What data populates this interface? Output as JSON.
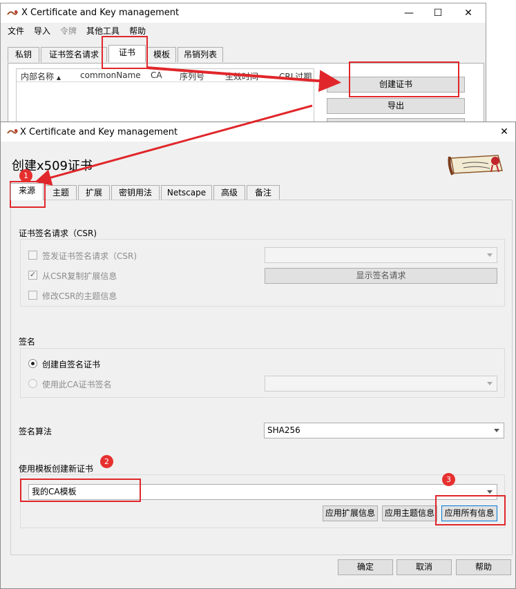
{
  "back_window": {
    "title": "X Certificate and Key management",
    "controls": {
      "minimize": "—",
      "maximize": "☐",
      "close": "✕"
    },
    "menu": [
      "文件",
      "导入",
      "令牌",
      "其他工具",
      "帮助"
    ],
    "tabs": [
      "私钥",
      "证书签名请求",
      "证书",
      "模板",
      "吊销列表"
    ],
    "columns": [
      "内部名称",
      "commonName",
      "CA",
      "序列号",
      "生效时间",
      "CRL过期"
    ],
    "sort_glyph": "▲",
    "buttons": {
      "create": "创建证书",
      "export": "导出"
    }
  },
  "dialog": {
    "title": "X Certificate and Key management",
    "close": "✕",
    "heading": "创建x509证书",
    "tabs": [
      "来源",
      "主题",
      "扩展",
      "密钥用法",
      "Netscape",
      "高级",
      "备注"
    ],
    "csr_section": {
      "title": "证书签名请求（CSR)",
      "sign_csr": "签发证书签名请求（CSR)",
      "copy_ext": "从CSR复制扩展信息",
      "modify_subject": "修改CSR的主题信息",
      "show_request": "显示签名请求",
      "check": "✓"
    },
    "signing": {
      "title": "签名",
      "self_signed": "创建自签名证书",
      "use_ca": "使用此CA证书签名"
    },
    "algorithm": {
      "label": "签名算法",
      "value": "SHA256"
    },
    "template": {
      "title": "使用模板创建新证书",
      "value": "我的CA模板",
      "apply_ext": "应用扩展信息",
      "apply_subject": "应用主题信息",
      "apply_all": "应用所有信息"
    },
    "footer": {
      "ok": "确定",
      "cancel": "取消",
      "help": "帮助"
    }
  },
  "annotations": {
    "step1": "1",
    "step2": "2",
    "step3": "3",
    "color": "#e0262a"
  }
}
